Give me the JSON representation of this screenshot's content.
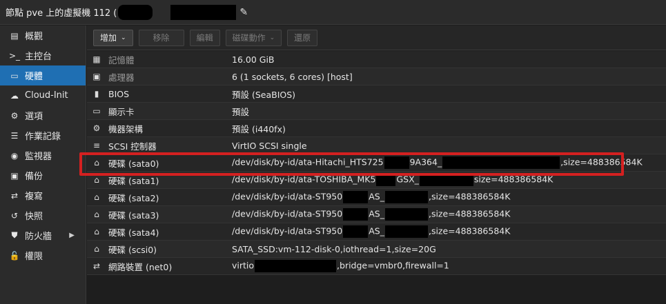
{
  "window": {
    "title": "節點 pve 上的虛擬機 112 (",
    "edit_icon": "pencil-icon"
  },
  "sidebar": {
    "items": [
      {
        "label": "概觀",
        "icon": "book-icon",
        "glyph": "▤"
      },
      {
        "label": "主控台",
        "icon": "terminal-icon",
        "glyph": ">_"
      },
      {
        "label": "硬體",
        "icon": "monitor-icon",
        "glyph": "▭",
        "active": true
      },
      {
        "label": "Cloud-Init",
        "icon": "cloud-icon",
        "glyph": "☁"
      },
      {
        "label": "選項",
        "icon": "gear-icon",
        "glyph": "⚙"
      },
      {
        "label": "作業記錄",
        "icon": "list-icon",
        "glyph": "☰"
      },
      {
        "label": "監視器",
        "icon": "eye-icon",
        "glyph": "◉"
      },
      {
        "label": "備份",
        "icon": "floppy-icon",
        "glyph": "▣"
      },
      {
        "label": "複寫",
        "icon": "retweet-icon",
        "glyph": "⇄"
      },
      {
        "label": "快照",
        "icon": "history-icon",
        "glyph": "↺"
      },
      {
        "label": "防火牆",
        "icon": "shield-icon",
        "glyph": "⛊",
        "has_submenu": true
      },
      {
        "label": "權限",
        "icon": "unlock-icon",
        "glyph": "🔓"
      }
    ]
  },
  "toolbar": {
    "add_label": "增加",
    "remove_label": "移除",
    "edit_label": "編輯",
    "disk_action_label": "磁碟動作",
    "revert_label": "還原"
  },
  "hardware": {
    "rows": [
      {
        "key": "記憶體",
        "value": "16.00 GiB",
        "icon": "memory-icon",
        "glyph": "▦",
        "dim": true
      },
      {
        "key": "處理器",
        "value": "6 (1 sockets, 6 cores) [host]",
        "icon": "cpu-icon",
        "glyph": "▣",
        "dim": true
      },
      {
        "key": "BIOS",
        "value": "預設 (SeaBIOS)",
        "icon": "microchip-icon",
        "glyph": "▮"
      },
      {
        "key": "顯示卡",
        "value": "預設",
        "icon": "desktop-icon",
        "glyph": "▭"
      },
      {
        "key": "機器架構",
        "value": "預設 (i440fx)",
        "icon": "cogs-icon",
        "glyph": "⚙"
      },
      {
        "key": "SCSI 控制器",
        "value": "VirtIO SCSI single",
        "icon": "database-icon",
        "glyph": "≡"
      },
      {
        "key": "硬碟 (sata0)",
        "value_parts": [
          "/dev/disk/by-id/ata-Hitachi_HTS725",
          "9A364_",
          ",size=488386584K"
        ],
        "icon": "hdd-icon",
        "glyph": "⌂"
      },
      {
        "key": "硬碟 (sata1)",
        "value_parts": [
          "/dev/disk/by-id/ata-TOSHIBA_MK5",
          "GSX_",
          "size=488386584K"
        ],
        "icon": "hdd-icon",
        "glyph": "⌂"
      },
      {
        "key": "硬碟 (sata2)",
        "value_parts": [
          "/dev/disk/by-id/ata-ST950",
          "AS_",
          ",size=488386584K"
        ],
        "icon": "hdd-icon",
        "glyph": "⌂"
      },
      {
        "key": "硬碟 (sata3)",
        "value_parts": [
          "/dev/disk/by-id/ata-ST950",
          "AS_",
          ",size=488386584K"
        ],
        "icon": "hdd-icon",
        "glyph": "⌂"
      },
      {
        "key": "硬碟 (sata4)",
        "value_parts": [
          "/dev/disk/by-id/ata-ST950",
          "AS_",
          ",size=488386584K"
        ],
        "icon": "hdd-icon",
        "glyph": "⌂"
      },
      {
        "key": "硬碟 (scsi0)",
        "value": "SATA_SSD:vm-112-disk-0,iothread=1,size=20G",
        "icon": "hdd-icon",
        "glyph": "⌂"
      },
      {
        "key": "網路裝置 (net0)",
        "value_parts": [
          "virtio",
          ",bridge=vmbr0,firewall=1"
        ],
        "icon": "exchange-icon",
        "glyph": "⇄"
      }
    ]
  },
  "colors": {
    "accent": "#1f6fb3",
    "highlight_box": "#d42020"
  }
}
